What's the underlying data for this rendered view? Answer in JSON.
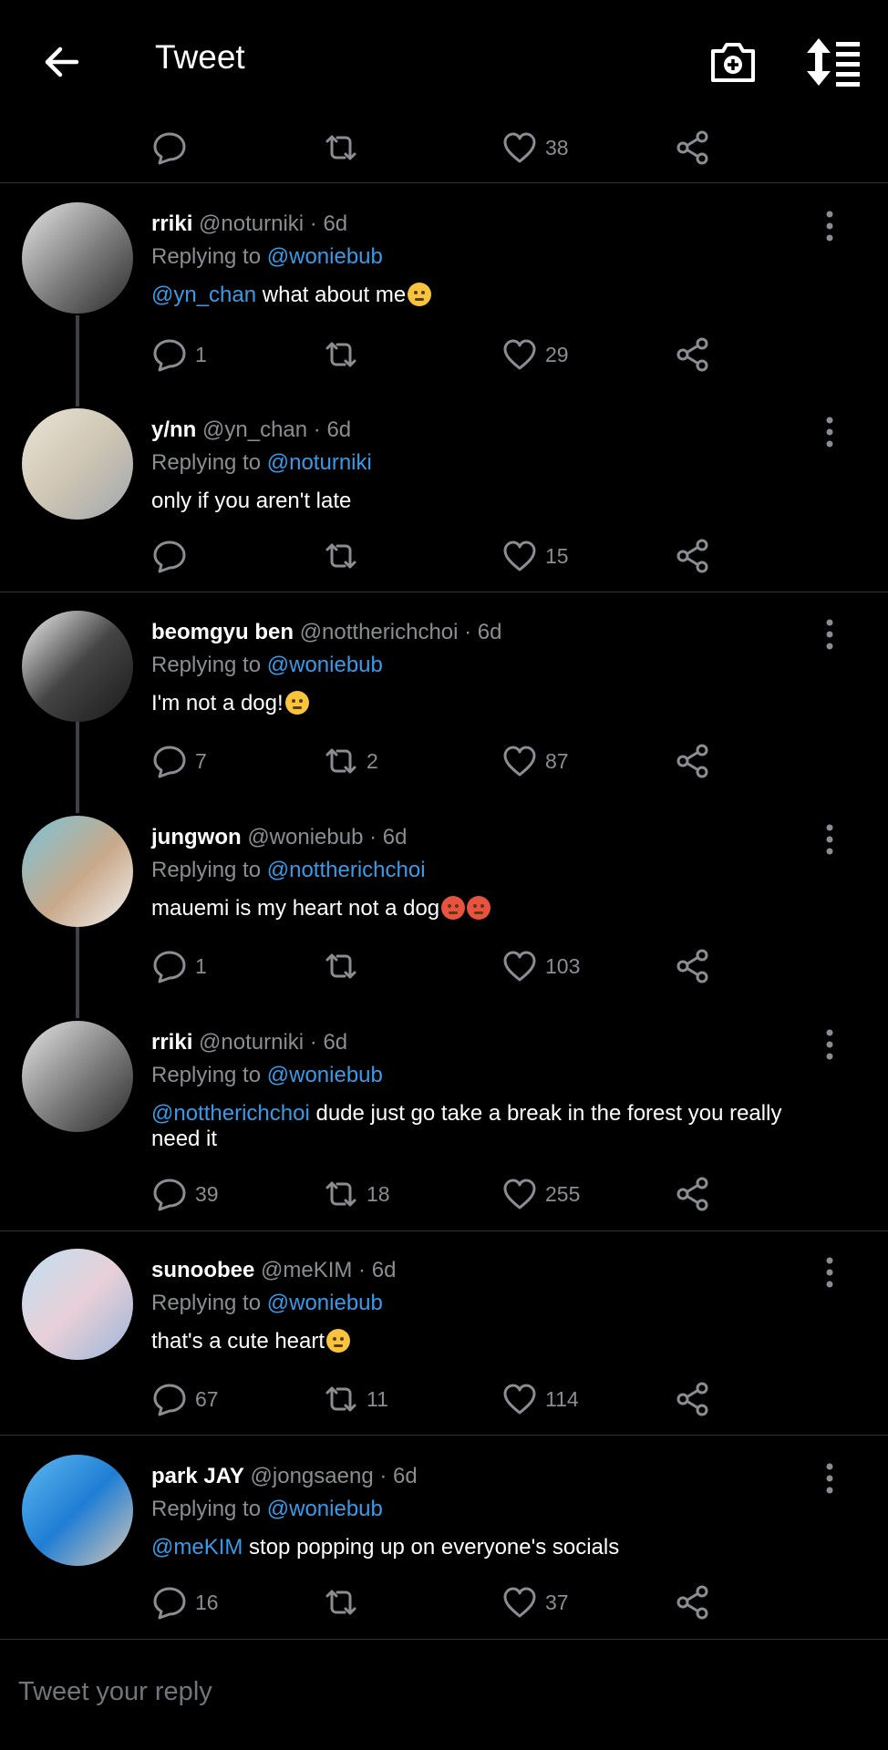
{
  "header": {
    "title": "Tweet"
  },
  "top_actions": {
    "likes": "38"
  },
  "tweets": [
    {
      "name": "rriki",
      "handle": "@noturniki · 6d",
      "replying_prefix": "Replying to ",
      "replying_to": "@woniebub",
      "mention": "@yn_chan",
      "text": " what about me",
      "emoji": [
        "pleading"
      ],
      "replies": "1",
      "retweets": "",
      "likes": "29"
    },
    {
      "name": "y/nn",
      "handle": "@yn_chan · 6d",
      "replying_prefix": "Replying to ",
      "replying_to": "@noturniki",
      "mention": "",
      "text": "only if you aren't late",
      "emoji": [],
      "replies": "",
      "retweets": "",
      "likes": "15"
    },
    {
      "name": "beomgyu ben",
      "handle": "@nottherichchoi · 6d",
      "replying_prefix": "Replying to ",
      "replying_to": "@woniebub",
      "mention": "",
      "text": "I'm not a dog!",
      "emoji": [
        "pensive"
      ],
      "replies": "7",
      "retweets": "2",
      "likes": "87"
    },
    {
      "name": "jungwon",
      "handle": "@woniebub · 6d",
      "replying_prefix": "Replying to ",
      "replying_to": "@nottherichchoi",
      "mention": "",
      "text": "mauemi is my heart not a dog",
      "emoji": [
        "angry",
        "angry"
      ],
      "replies": "1",
      "retweets": "",
      "likes": "103"
    },
    {
      "name": "rriki",
      "handle": "@noturniki · 6d",
      "replying_prefix": "Replying to ",
      "replying_to": "@woniebub",
      "mention": "@nottherichchoi",
      "text": " dude just go take a break in the forest you really need it",
      "emoji": [],
      "replies": "39",
      "retweets": "18",
      "likes": "255"
    },
    {
      "name": "sunoobee",
      "handle": "@meKIM · 6d",
      "replying_prefix": "Replying to ",
      "replying_to": "@woniebub",
      "mention": "",
      "text": "that's a cute heart",
      "emoji": [
        "smiling-hearts"
      ],
      "replies": "67",
      "retweets": "11",
      "likes": "114"
    },
    {
      "name": "park JAY",
      "handle": "@jongsaeng · 6d",
      "replying_prefix": "Replying to ",
      "replying_to": "@woniebub",
      "mention": "@meKIM",
      "text": " stop popping up on everyone's socials",
      "emoji": [],
      "replies": "16",
      "retweets": "",
      "likes": "37"
    }
  ],
  "reply_box": {
    "placeholder": "Tweet your reply"
  },
  "colors": {
    "background": "#000000",
    "accent": "#3b9ae8",
    "muted": "#8a8d91"
  },
  "icons": [
    "back-arrow-icon",
    "camera-add-icon",
    "sort-icon",
    "reply-icon",
    "retweet-icon",
    "like-icon",
    "share-icon",
    "more-icon"
  ]
}
